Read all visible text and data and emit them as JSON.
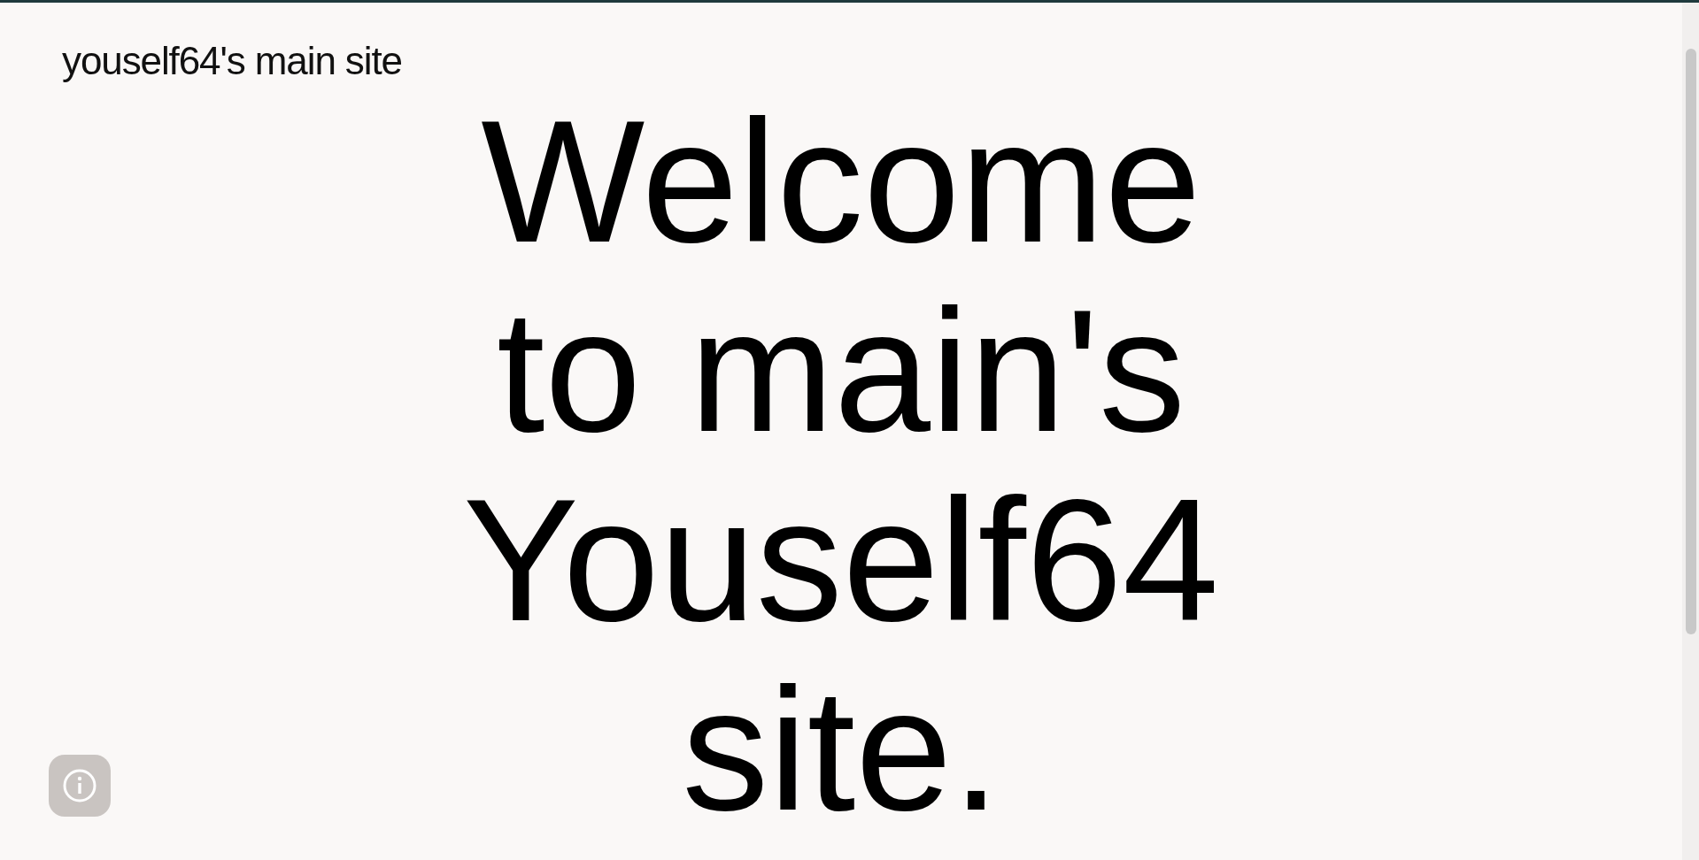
{
  "header": {
    "site_title": "youself64's main site"
  },
  "hero": {
    "heading": "Welcome to main's Youself64 site."
  },
  "info_button": {
    "kind": "info"
  }
}
